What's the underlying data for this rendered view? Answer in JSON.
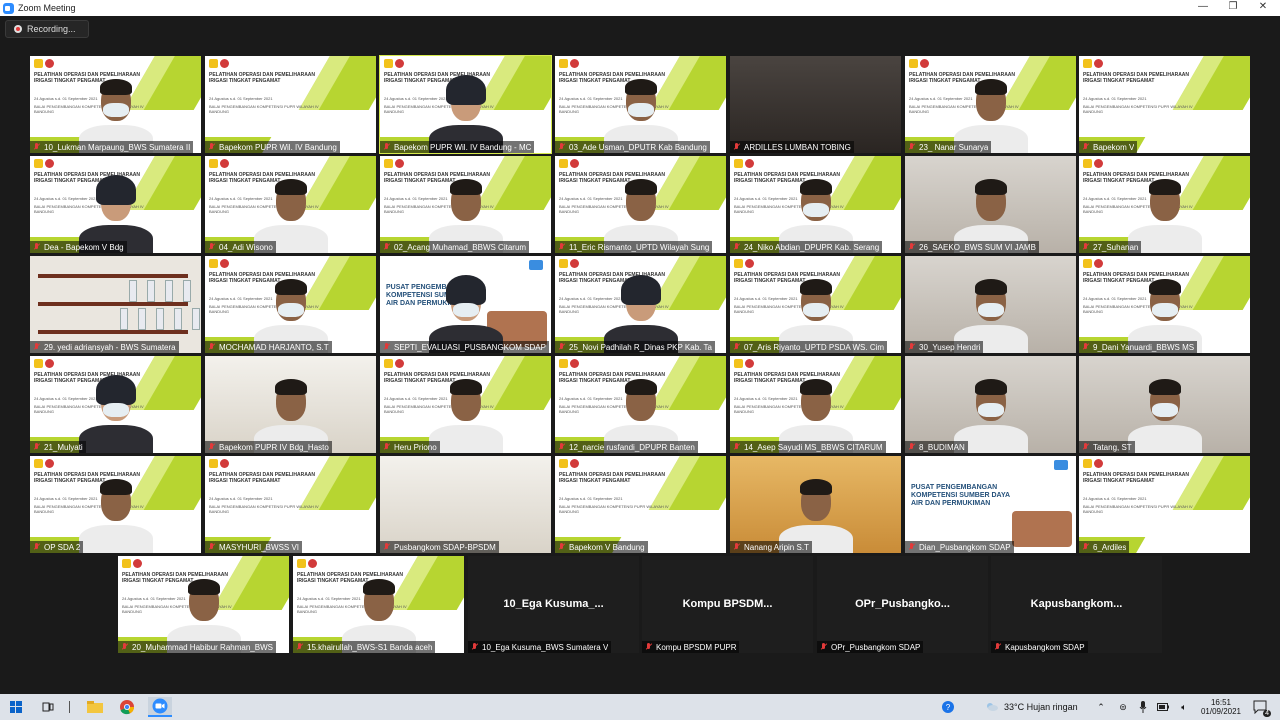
{
  "window": {
    "title": "Zoom Meeting",
    "minimize": "—",
    "maximize": "❐",
    "close": "✕"
  },
  "recording": {
    "label": "Recording..."
  },
  "tiles": [
    {
      "name": "10_Lukman Marpaung_BWS Sumatera II",
      "kind": "slide",
      "person": "mask"
    },
    {
      "name": "Bapekom PUPR Wil. IV Bandung",
      "kind": "slide",
      "person": "none"
    },
    {
      "name": "Bapekom PUPR Wil. IV Bandung - MC",
      "kind": "slide",
      "person": "hijab",
      "active": true
    },
    {
      "name": "03_Ade Usman_DPUTR Kab Bandung",
      "kind": "slide",
      "person": "mask"
    },
    {
      "name": "ARDILLES LUMBAN TOBING",
      "kind": "dark",
      "person": "none"
    },
    {
      "name": "23_ Nanar Sunarya",
      "kind": "slide",
      "person": "plain"
    },
    {
      "name": "Bapekom V",
      "kind": "slide",
      "person": "none"
    },
    {
      "name": "Dea - Bapekom V Bdg",
      "kind": "slide",
      "person": "hijab"
    },
    {
      "name": "04_Adi Wisono",
      "kind": "slide",
      "person": "plain"
    },
    {
      "name": "02_Acang Muhamad_BBWS Citarum",
      "kind": "slide",
      "person": "plain"
    },
    {
      "name": "11_Eric Rismanto_UPTD Wilayah Sung",
      "kind": "slide",
      "person": "plain"
    },
    {
      "name": "24_Niko Abdian_DPUPR Kab. Serang",
      "kind": "slide",
      "person": "mask"
    },
    {
      "name": "26_SAEKO_BWS SUM VI JAMB",
      "kind": "room",
      "person": "plain"
    },
    {
      "name": "27_Suhanan",
      "kind": "slide",
      "person": "plain"
    },
    {
      "name": "29. yedi adriansyah - BWS Sumatera",
      "kind": "shelf",
      "person": "none"
    },
    {
      "name": "MOCHAMAD HARJANTO, S.T",
      "kind": "slide",
      "person": "mask"
    },
    {
      "name": "SEPTI_EVALUASI_PUSBANGKOM SDAP",
      "kind": "poster",
      "person": "hijab-mask"
    },
    {
      "name": "25_Novi Padhilah R_Dinas PKP Kab. Ta",
      "kind": "slide",
      "person": "hijab"
    },
    {
      "name": "07_Aris Riyanto_UPTD PSDA WS. Cim",
      "kind": "slide",
      "person": "mask"
    },
    {
      "name": "30_Yusep Hendri",
      "kind": "room",
      "person": "mask"
    },
    {
      "name": "9_Dani Yanuardi_BBWS MS",
      "kind": "slide",
      "person": "mask"
    },
    {
      "name": "21_Mulyati",
      "kind": "slide",
      "person": "hijab-mask"
    },
    {
      "name": "Bapekom PUPR IV Bdg_Hasto",
      "kind": "office",
      "person": "plain"
    },
    {
      "name": "Heru Priono",
      "kind": "slide",
      "person": "plain"
    },
    {
      "name": "12_narcie rusfandi_DPUPR Banten",
      "kind": "slide",
      "person": "plain"
    },
    {
      "name": "14_Asep Sayudi MS_BBWS CITARUM",
      "kind": "slide",
      "person": "plain"
    },
    {
      "name": "8_BUDIMAN",
      "kind": "room",
      "person": "mask"
    },
    {
      "name": "Tatang, ST",
      "kind": "room",
      "person": "mask"
    },
    {
      "name": "OP SDA 2",
      "kind": "slide",
      "person": "plain"
    },
    {
      "name": "MASYHURI_BWSS VI",
      "kind": "slide",
      "person": "none"
    },
    {
      "name": "Pusbangkom SDAP-BPSDM",
      "kind": "office",
      "person": "none"
    },
    {
      "name": "Bapekom V Bandung",
      "kind": "slide",
      "person": "none"
    },
    {
      "name": "Nanang Aripin S.T",
      "kind": "yellow",
      "person": "plain"
    },
    {
      "name": "Dian_Pusbangkom SDAP",
      "kind": "poster",
      "person": "none"
    },
    {
      "name": "6_Ardiles",
      "kind": "slide",
      "person": "none"
    },
    {
      "name": "20_Muhammad Habibur Rahman_BWS",
      "kind": "slide",
      "person": "plain"
    },
    {
      "name": "15.khairullah_BWS-S1 Banda aceh",
      "kind": "slide",
      "person": "plain"
    },
    {
      "name": "10_Ega Kusuma_BWS Sumatera V",
      "kind": "blank",
      "bigname": "10_Ega Kusuma_..."
    },
    {
      "name": "Kompu BPSDM PUPR",
      "kind": "blank",
      "bigname": "Kompu BPSDM..."
    },
    {
      "name": "OPr_Pusbangkom SDAP",
      "kind": "blank",
      "bigname": "OPr_Pusbangko..."
    },
    {
      "name": "Kapusbangkom SDAP",
      "kind": "blank",
      "bigname": "Kapusbangkom..."
    }
  ],
  "slide": {
    "line1": "PELATIHAN",
    "line2": "OPERASI DAN PEMELIHARAAN IRIGASI",
    "line3": "TINGKAT PENGAMAT",
    "date": "24 Agustus s.d. 01 September 2021",
    "org": "BALAI PENGEMBANGAN KOMPETENSI PUPR WILAYAH IV BANDUNG"
  },
  "poster": {
    "text": "PUSAT PENGEMBANGAN KOMPETENSI SUMBER DAYA AIR DAN PERMUKIMAN"
  },
  "taskbar": {
    "weather": "33°C  Hujan ringan",
    "time": "16:51",
    "date": "01/09/2021",
    "notifications": "4"
  },
  "colors": {
    "accent_green": "#b7d531",
    "muted_red": "#e23a3a",
    "zoom_blue": "#2d8cff"
  }
}
